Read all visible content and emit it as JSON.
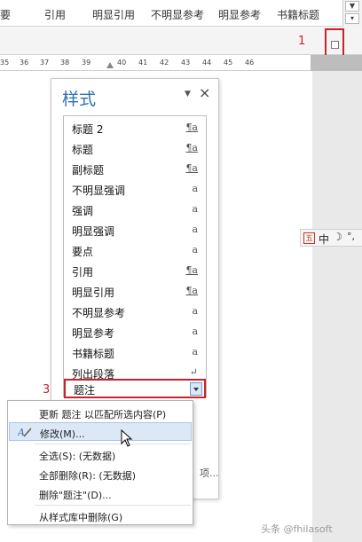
{
  "gallery": {
    "items": [
      "要",
      "引用",
      "明显引用",
      "不明显参考",
      "明显参考",
      "书籍标题"
    ]
  },
  "markers": {
    "launcher_num": "1",
    "selected_num": "3"
  },
  "ruler": {
    "ticks": [
      "35",
      "36",
      "37",
      "38",
      "39",
      "40",
      "41",
      "42",
      "43",
      "44",
      "45",
      "46"
    ]
  },
  "styles_pane": {
    "title": "样式",
    "menu_glyph": "▼",
    "close_glyph": "×",
    "items": [
      {
        "name": "标题 2",
        "type": "¶a"
      },
      {
        "name": "标题",
        "type": "¶a"
      },
      {
        "name": "副标题",
        "type": "¶a"
      },
      {
        "name": "不明显强调",
        "type": "a"
      },
      {
        "name": "强调",
        "type": "a"
      },
      {
        "name": "明显强调",
        "type": "a"
      },
      {
        "name": "要点",
        "type": "a"
      },
      {
        "name": "引用",
        "type": "¶a"
      },
      {
        "name": "明显引用",
        "type": "¶a"
      },
      {
        "name": "不明显参考",
        "type": "a"
      },
      {
        "name": "明显参考",
        "type": "a"
      },
      {
        "name": "书籍标题",
        "type": "a"
      },
      {
        "name": "列出段落",
        "type": "↵"
      },
      {
        "name": "题注",
        "type": ""
      }
    ],
    "bottom_text": "项..."
  },
  "context_menu": {
    "items": [
      "更新 题注 以匹配所选内容(P)",
      "修改(M)...",
      "全选(S): (无数据)",
      "全部删除(R): (无数据)",
      "删除\"题注\"(D)...",
      "从样式库中删除(G)"
    ]
  },
  "ime": {
    "badge": "五",
    "mode": "中",
    "moon": "☽",
    "punct": "°,"
  },
  "watermark": "头条 @fhilasoft"
}
